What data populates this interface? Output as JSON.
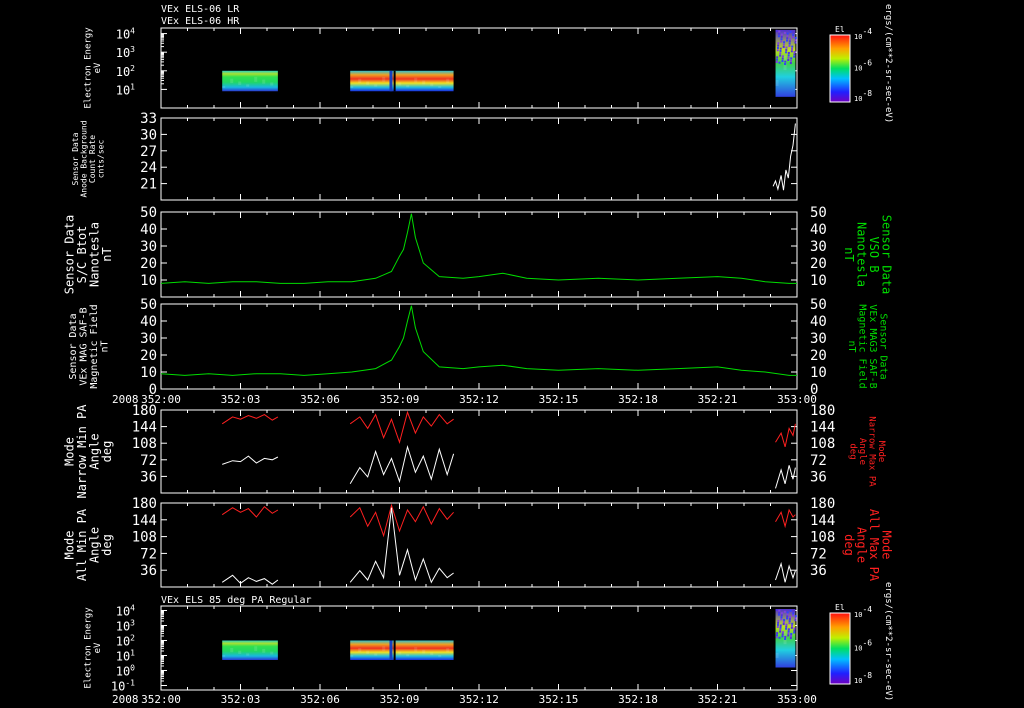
{
  "chart_data": {
    "type": "line",
    "header_lines": [
      "VEx ELS-06 LR",
      "VEx ELS-06 HR"
    ],
    "year_label": "2008",
    "time_ticks": [
      "352:00",
      "352:03",
      "352:06",
      "352:09",
      "352:12",
      "352:15",
      "352:18",
      "352:21",
      "353:00"
    ],
    "x_range": [
      0,
      8
    ],
    "colors": {
      "white": "#ffffff",
      "green": "#00dd00",
      "red": "#ff2020",
      "background": "#000000"
    },
    "colorbar": {
      "title": "El",
      "ticks": [
        "10^-4",
        "10^-6",
        "10^-8"
      ],
      "unit_label": "ergs/(cm**2-sr-sec-eV)",
      "scale": "log"
    },
    "panels": [
      {
        "id": "p1",
        "kind": "spectrogram",
        "left_label": [
          "Electron Energy",
          "eV"
        ],
        "y_ticks": [
          "10^4",
          "10^3",
          "10^2",
          "10^1"
        ],
        "y_range_log": [
          0,
          4.3
        ],
        "blocks": [
          {
            "x0": 0.77,
            "x1": 1.47,
            "lo": 0.9,
            "hi": 2.0,
            "style": "moderate"
          },
          {
            "x0": 2.38,
            "x1": 3.68,
            "lo": 0.9,
            "hi": 2.0,
            "style": "intense"
          },
          {
            "x0": 7.73,
            "x1": 7.98,
            "lo": 0.6,
            "hi": 4.2,
            "style": "sparse"
          }
        ],
        "colorbar": true
      },
      {
        "id": "p2",
        "kind": "line",
        "left_label": [
          "Sensor Data",
          "Anode Background",
          "Count Rate",
          "cnts/sec"
        ],
        "y_ticks": [
          33,
          30,
          27,
          24,
          21
        ],
        "y_range": [
          18,
          33
        ],
        "series": [
          {
            "color": "white",
            "x": [
              7.7,
              7.73,
              7.76,
              7.8,
              7.83,
              7.86,
              7.89,
              7.92,
              7.95,
              7.98
            ],
            "y": [
              20.5,
              21.5,
              20.0,
              22.5,
              19.8,
              23.5,
              22.0,
              26.0,
              28.0,
              32.0
            ]
          }
        ]
      },
      {
        "id": "p3",
        "kind": "line",
        "left_label": [
          "Sensor Data",
          "S/C Btot",
          "Nanotesla",
          "nT"
        ],
        "right_label": [
          "Sensor Data",
          "VSO B",
          "Nanotesla",
          "nT"
        ],
        "right_color": "green",
        "y_ticks": [
          50,
          40,
          30,
          20,
          10
        ],
        "right_ticks": [
          50,
          40,
          30,
          20,
          10
        ],
        "y_range": [
          0,
          50
        ],
        "series": [
          {
            "color": "green",
            "x": [
              0,
              0.3,
              0.6,
              0.9,
              1.2,
              1.5,
              1.8,
              2.1,
              2.4,
              2.7,
              2.9,
              3.0,
              3.05,
              3.1,
              3.15,
              3.2,
              3.3,
              3.5,
              3.8,
              4.0,
              4.3,
              4.6,
              5.0,
              5.5,
              6.0,
              6.5,
              7.0,
              7.3,
              7.6,
              7.9,
              8.0
            ],
            "y": [
              8,
              9,
              8,
              9,
              9,
              8,
              8,
              9,
              9,
              11,
              15,
              24,
              28,
              38,
              49,
              35,
              20,
              12,
              11,
              12,
              14,
              11,
              10,
              11,
              10,
              11,
              12,
              11,
              9,
              8,
              8
            ]
          }
        ]
      },
      {
        "id": "p4",
        "kind": "line",
        "left_label": [
          "Sensor Data",
          "VEx MAG SAF-B",
          "Magnetic Field",
          "nT"
        ],
        "right_label": [
          "Sensor Data",
          "VEx MAG3 SAF-B",
          "Magnetic Field",
          "nT"
        ],
        "right_color": "green",
        "y_ticks": [
          50,
          40,
          30,
          20,
          10,
          0
        ],
        "right_ticks": [
          50,
          40,
          30,
          20,
          10,
          0
        ],
        "y_range": [
          0,
          50
        ],
        "series": [
          {
            "color": "green",
            "x": [
              0,
              0.3,
              0.6,
              0.9,
              1.2,
              1.5,
              1.8,
              2.1,
              2.4,
              2.7,
              2.9,
              3.0,
              3.05,
              3.1,
              3.15,
              3.2,
              3.3,
              3.5,
              3.8,
              4.0,
              4.3,
              4.6,
              5.0,
              5.5,
              6.0,
              6.5,
              7.0,
              7.3,
              7.6,
              7.9,
              8.0
            ],
            "y": [
              9,
              8,
              9,
              8,
              9,
              9,
              8,
              9,
              10,
              12,
              17,
              25,
              30,
              40,
              49,
              36,
              22,
              13,
              12,
              13,
              14,
              12,
              11,
              12,
              11,
              12,
              13,
              11,
              10,
              8,
              8
            ]
          }
        ]
      },
      {
        "id": "p5",
        "kind": "line",
        "left_label": [
          "Mode",
          "Narrow Min PA",
          "Angle",
          "deg"
        ],
        "right_label": [
          "Mode",
          "Narrow Max PA",
          "Angle",
          "deg"
        ],
        "right_color": "red",
        "y_ticks": [
          180,
          144,
          108,
          72,
          36
        ],
        "right_ticks": [
          180,
          144,
          108,
          72,
          36
        ],
        "y_range": [
          0,
          180
        ],
        "series": [
          {
            "color": "red",
            "x": [
              0.77,
              0.9,
              1.0,
              1.1,
              1.2,
              1.3,
              1.4,
              1.47
            ],
            "y": [
              150,
              165,
              160,
              168,
              162,
              170,
              158,
              165
            ]
          },
          {
            "color": "white",
            "x": [
              0.77,
              0.9,
              1.0,
              1.1,
              1.2,
              1.3,
              1.4,
              1.47
            ],
            "y": [
              62,
              70,
              68,
              80,
              65,
              75,
              72,
              78
            ]
          },
          {
            "color": "red",
            "x": [
              2.38,
              2.5,
              2.6,
              2.7,
              2.8,
              2.9,
              3.0,
              3.1,
              3.2,
              3.3,
              3.4,
              3.5,
              3.6,
              3.68
            ],
            "y": [
              150,
              165,
              140,
              170,
              120,
              160,
              110,
              175,
              130,
              165,
              145,
              170,
              150,
              160
            ]
          },
          {
            "color": "white",
            "x": [
              2.38,
              2.5,
              2.6,
              2.7,
              2.8,
              2.9,
              3.0,
              3.1,
              3.2,
              3.3,
              3.4,
              3.5,
              3.6,
              3.68
            ],
            "y": [
              20,
              55,
              35,
              90,
              40,
              75,
              25,
              100,
              45,
              80,
              30,
              95,
              40,
              85
            ]
          },
          {
            "color": "red",
            "x": [
              7.73,
              7.8,
              7.85,
              7.9,
              7.95,
              7.98
            ],
            "y": [
              110,
              130,
              100,
              140,
              125,
              150
            ]
          },
          {
            "color": "white",
            "x": [
              7.73,
              7.8,
              7.85,
              7.9,
              7.95,
              7.98
            ],
            "y": [
              10,
              50,
              20,
              60,
              30,
              55
            ]
          }
        ]
      },
      {
        "id": "p6",
        "kind": "line",
        "left_label": [
          "Mode",
          "All Min PA",
          "Angle",
          "deg"
        ],
        "right_label": [
          "Mode",
          "All Max PA",
          "Angle",
          "deg"
        ],
        "right_color": "red",
        "y_ticks": [
          180,
          144,
          108,
          72,
          36
        ],
        "right_ticks": [
          180,
          144,
          108,
          72,
          36
        ],
        "y_range": [
          0,
          180
        ],
        "series": [
          {
            "color": "red",
            "x": [
              0.77,
              0.9,
              1.0,
              1.1,
              1.2,
              1.3,
              1.4,
              1.47
            ],
            "y": [
              155,
              170,
              160,
              168,
              150,
              172,
              158,
              165
            ]
          },
          {
            "color": "white",
            "x": [
              0.77,
              0.9,
              1.0,
              1.1,
              1.2,
              1.3,
              1.4,
              1.47
            ],
            "y": [
              10,
              25,
              8,
              20,
              12,
              18,
              6,
              15
            ]
          },
          {
            "color": "red",
            "x": [
              2.38,
              2.5,
              2.6,
              2.7,
              2.8,
              2.9,
              3.0,
              3.1,
              3.2,
              3.3,
              3.4,
              3.5,
              3.6,
              3.68
            ],
            "y": [
              150,
              170,
              130,
              160,
              110,
              175,
              120,
              165,
              140,
              172,
              135,
              168,
              145,
              160
            ]
          },
          {
            "color": "white",
            "x": [
              2.38,
              2.5,
              2.6,
              2.7,
              2.8,
              2.9,
              3.0,
              3.1,
              3.2,
              3.3,
              3.4,
              3.5,
              3.6,
              3.68
            ],
            "y": [
              10,
              35,
              15,
              55,
              20,
              170,
              25,
              80,
              15,
              60,
              10,
              40,
              20,
              30
            ]
          },
          {
            "color": "red",
            "x": [
              7.73,
              7.8,
              7.85,
              7.9,
              7.95,
              7.98
            ],
            "y": [
              140,
              160,
              130,
              165,
              150,
              155
            ]
          },
          {
            "color": "white",
            "x": [
              7.73,
              7.8,
              7.85,
              7.9,
              7.95,
              7.98
            ],
            "y": [
              15,
              50,
              10,
              45,
              20,
              35
            ]
          }
        ]
      },
      {
        "id": "p7",
        "kind": "spectrogram",
        "title": "VEx ELS 85 deg PA Regular",
        "left_label": [
          "Electron Energy",
          "eV"
        ],
        "y_ticks": [
          "10^4",
          "10^3",
          "10^2",
          "10^1",
          "10^0",
          "10^-1"
        ],
        "y_range_log": [
          -1.3,
          4.3
        ],
        "blocks": [
          {
            "x0": 0.77,
            "x1": 1.47,
            "lo": 0.7,
            "hi": 2.0,
            "style": "moderate"
          },
          {
            "x0": 2.38,
            "x1": 3.68,
            "lo": 0.7,
            "hi": 2.0,
            "style": "intense"
          },
          {
            "x0": 7.73,
            "x1": 7.98,
            "lo": 0.2,
            "hi": 4.1,
            "style": "sparse"
          }
        ],
        "colorbar": true
      }
    ]
  }
}
